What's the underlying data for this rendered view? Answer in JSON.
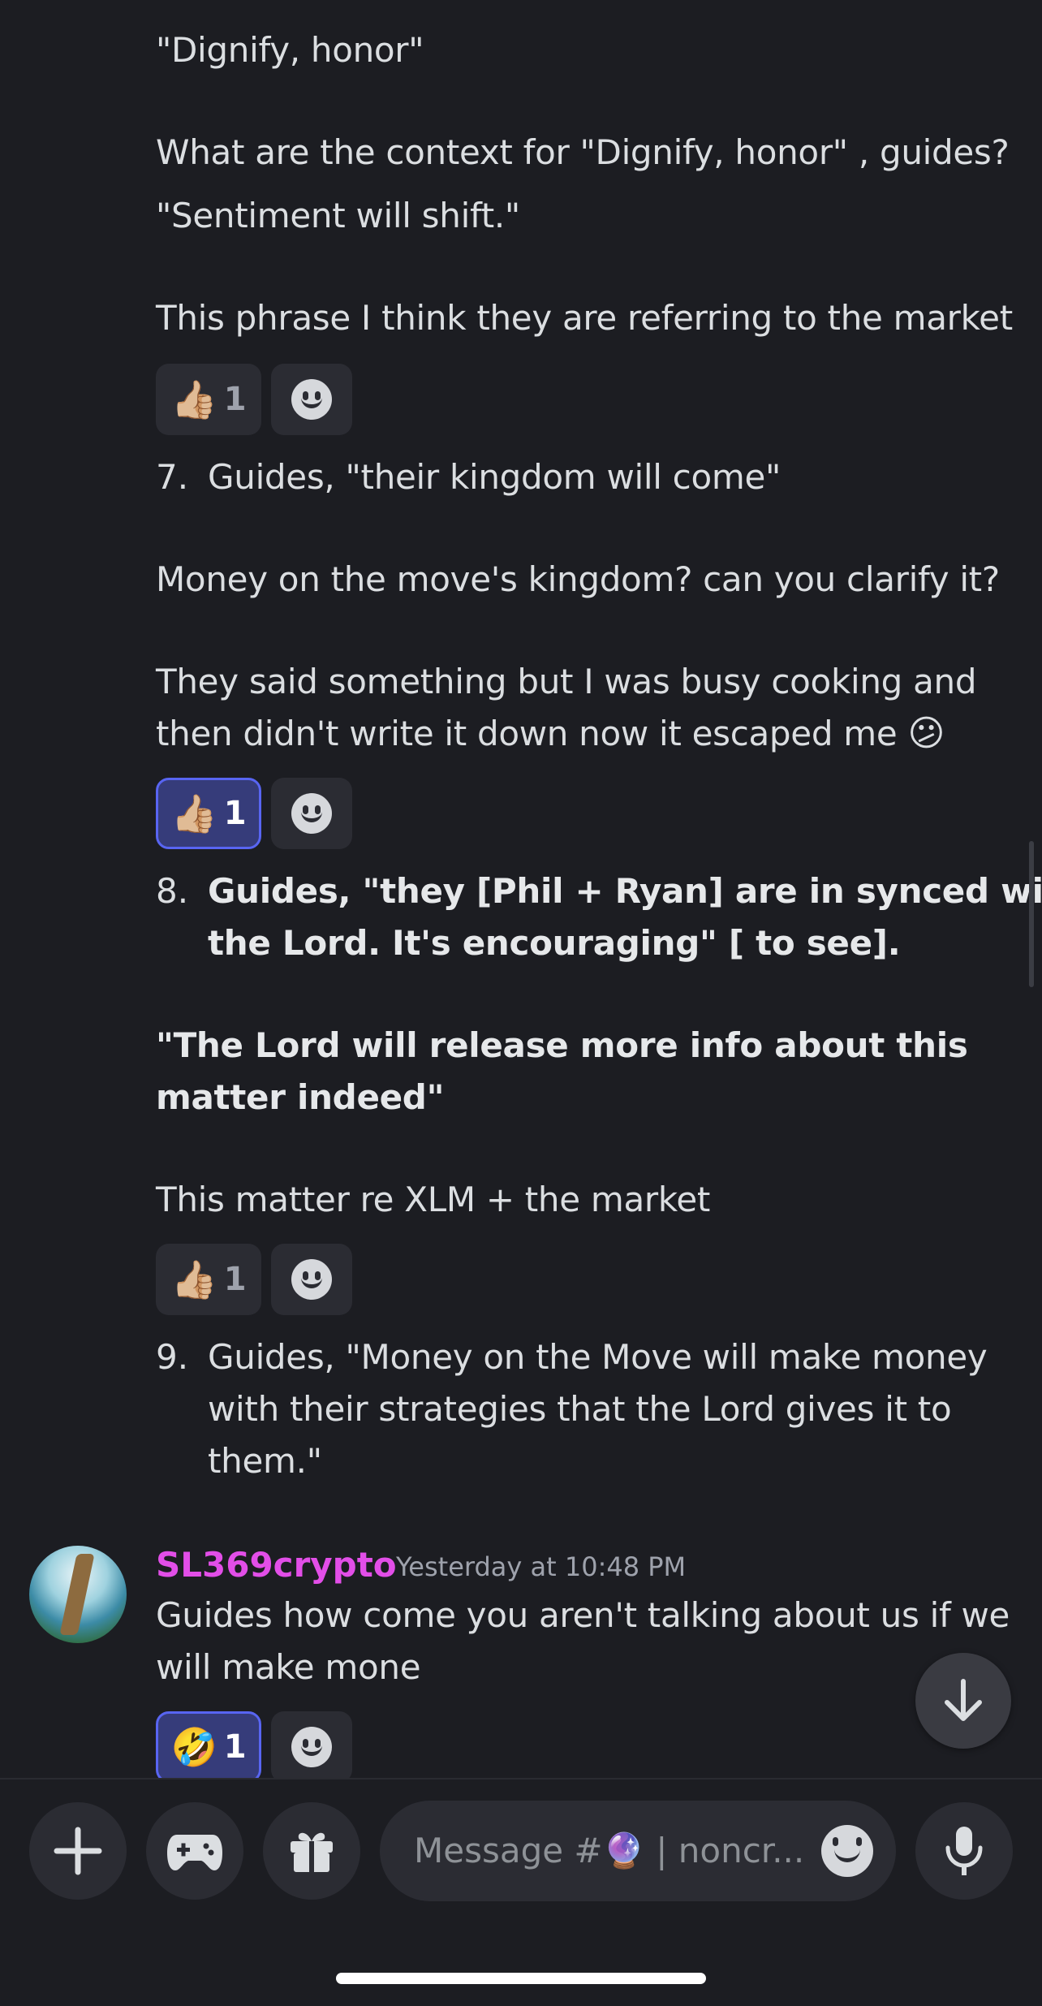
{
  "messages": {
    "m1": "\"Dignify, honor\"",
    "m2": "What are the context for \"Dignify, honor\" , guides?",
    "m3": "\"Sentiment will shift.\"",
    "m4": "This phrase I think they are referring to the market",
    "r1": {
      "emoji": "👍🏼",
      "count": "1"
    },
    "i7_num": "7.",
    "i7": "Guides, \"their kingdom will come\"",
    "m5": "Money on the move's kingdom? can you clarify it?",
    "m6a": "They said something but I was busy cooking and",
    "m6b": "then didn't write it down now it escaped me",
    "m6_emoji": "😕",
    "r2": {
      "emoji": "👍🏼",
      "count": "1"
    },
    "i8_num": "8.",
    "i8a": "Guides, \"they [Phil + Ryan] are in synced with",
    "i8b": "the Lord.  It's encouraging\" [ to see].",
    "m7a": "\"The Lord will release more info about this",
    "m7b": "matter indeed\"",
    "m8": "This matter re XLM + the market",
    "r3": {
      "emoji": "👍🏼",
      "count": "1"
    },
    "i9_num": "9.",
    "i9a": "Guides, \"Money on the Move will make money",
    "i9b": "with their strategies that the Lord gives it to",
    "i9c": "them.\""
  },
  "post": {
    "username": "SL369crypto",
    "timestamp": "Yesterday at 10:48 PM",
    "line1": "Guides how come you aren't talking about us if we",
    "line2": "will make mone",
    "reaction": {
      "emoji": "🤣",
      "count": "1"
    }
  },
  "composer": {
    "placeholder": "Message #🔮 | noncr...",
    "icons": [
      "plus-icon",
      "gamepad-icon",
      "gift-icon",
      "emoji-icon",
      "microphone-icon"
    ]
  },
  "colors": {
    "background": "#1c1d22",
    "username": "#e24ee8",
    "active_reaction": "#5865f2"
  }
}
